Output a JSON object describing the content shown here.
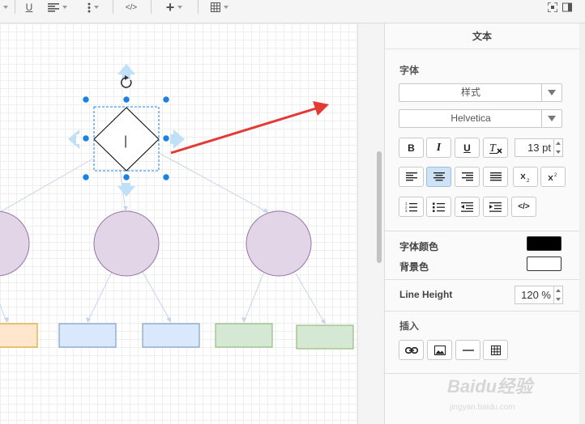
{
  "toolbar": {
    "underline_label": "U",
    "code_label": "</>",
    "plus_label": "+"
  },
  "canvas": {
    "text_cursor": "|"
  },
  "panel": {
    "header": "文本",
    "font_section": "字体",
    "style_select": "样式",
    "font_family": "Helvetica",
    "bold_label": "B",
    "italic_label": "I",
    "underline_label": "U",
    "font_size": "13 pt",
    "code_label": "</>",
    "font_color_label": "字体颜色",
    "bg_color_label": "背景色",
    "font_color": "#000000",
    "bg_color": "#ffffff",
    "line_height_label": "Line Height",
    "line_height_value": "120 %",
    "insert_section": "插入"
  },
  "colors": {
    "accent": "#1a82e2",
    "circle_fill": "#e1d5e7",
    "circle_stroke": "#9673a6",
    "orange_fill": "#ffe6cc",
    "orange_stroke": "#d79b00",
    "blue_fill": "#dae8fc",
    "blue_stroke": "#6c8ebf",
    "green_fill": "#d5e8d4",
    "green_stroke": "#82b366",
    "arrow": "#e53935"
  },
  "watermark": {
    "main": "Baidu经验",
    "sub": "jingyan.baidu.com"
  }
}
